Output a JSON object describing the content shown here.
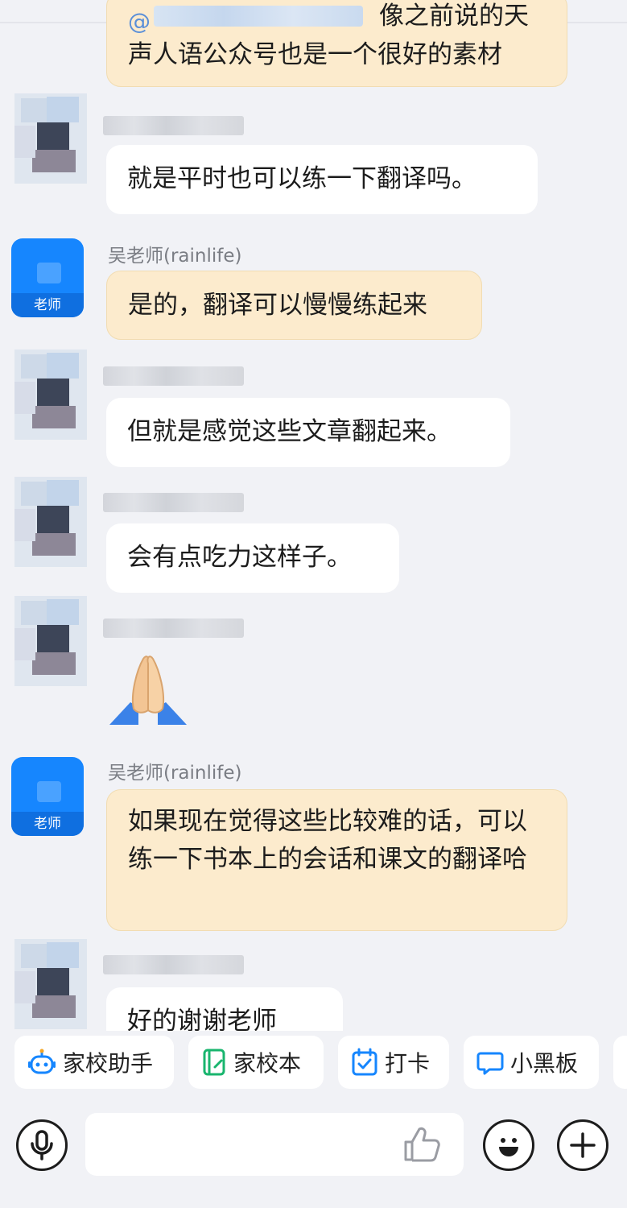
{
  "messages": {
    "m1": {
      "line1_partial": "像之前说的天",
      "line2": "声人语公众号也是一个很好的素材"
    },
    "m2": {
      "text": "就是平时也可以练一下翻译吗。"
    },
    "m3": {
      "sender": "吴老师(rainlife)",
      "text": "是的，翻译可以慢慢练起来"
    },
    "m4": {
      "text": "但就是感觉这些文章翻起来。"
    },
    "m5": {
      "text": "会有点吃力这样子。"
    },
    "m7": {
      "sender": "吴老师(rainlife)",
      "text": "如果现在觉得这些比较难的话，可以练一下书本上的会话和课文的翻译哈"
    },
    "m8": {
      "text_partial": "好的谢谢老师"
    }
  },
  "teacher_badge": "老师",
  "quick_actions": [
    {
      "label": "家校助手",
      "icon": "robot-icon"
    },
    {
      "label": "家校本",
      "icon": "notebook-icon"
    },
    {
      "label": "打卡",
      "icon": "calendar-check-icon"
    },
    {
      "label": "小黑板",
      "icon": "chat-board-icon"
    }
  ],
  "input": {
    "placeholder": ""
  },
  "colors": {
    "teacher_avatar": "#1686fe",
    "teacher_bubble": "#fcebcd",
    "peer_bubble": "#ffffff",
    "background": "#f1f2f6"
  }
}
